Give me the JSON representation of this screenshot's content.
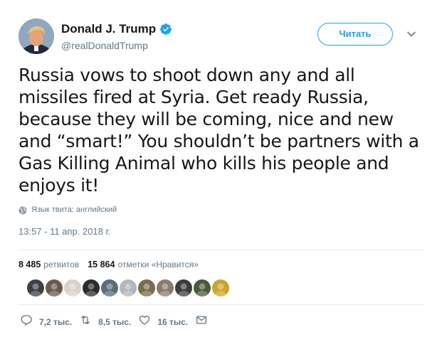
{
  "header": {
    "display_name": "Donald J. Trump",
    "handle": "@realDonaldTrump",
    "follow_label": "Читать"
  },
  "tweet": {
    "text": "Russia vows to shoot down any and all missiles fired at Syria. Get ready Russia, because they will be coming, nice and new and “smart!” You shouldn’t be partners with a Gas Killing Animal who kills his people and enjoys it!",
    "language_note": "Язык твита: английский",
    "timestamp": "13:57 - 11 апр. 2018 г."
  },
  "stats": {
    "retweets_count": "8 485",
    "retweets_label": "ретвитов",
    "likes_count": "15 864",
    "likes_label": "отметки «Нравится»"
  },
  "likers": [
    {
      "name": "liker-avatar-1",
      "color": "#3b3f46"
    },
    {
      "name": "liker-avatar-2",
      "color": "#6a5a4a"
    },
    {
      "name": "liker-avatar-3",
      "color": "#d8d2c8"
    },
    {
      "name": "liker-avatar-4",
      "color": "#2c2c2c"
    },
    {
      "name": "liker-avatar-5",
      "color": "#5a6b7a"
    },
    {
      "name": "liker-avatar-6",
      "color": "#b0b6bc"
    },
    {
      "name": "liker-avatar-7",
      "color": "#7a6a4e"
    },
    {
      "name": "liker-avatar-8",
      "color": "#8c7a6c"
    },
    {
      "name": "liker-avatar-9",
      "color": "#3c3c3c"
    },
    {
      "name": "liker-avatar-10",
      "color": "#4a5a3a"
    },
    {
      "name": "liker-avatar-11",
      "color": "#c9a62a"
    }
  ],
  "actions": {
    "reply_count": "7,2 тыс.",
    "retweet_count": "8,5 тыс.",
    "like_count": "16 тыс."
  },
  "colors": {
    "accent": "#1da1f2",
    "secondary_text": "#657786"
  },
  "icons": [
    "verified-badge-icon",
    "chevron-down-icon",
    "globe-icon",
    "reply-icon",
    "retweet-icon",
    "heart-icon",
    "envelope-icon"
  ]
}
